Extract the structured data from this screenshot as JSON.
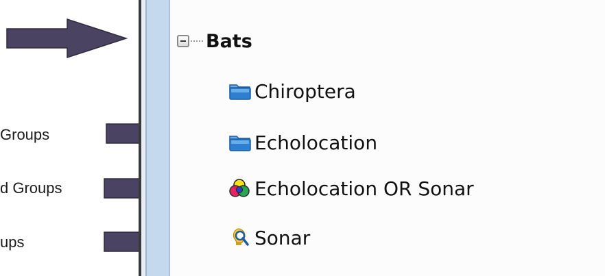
{
  "annotations": {
    "label_1": "Groups",
    "label_2": "d Groups",
    "label_3": "ups"
  },
  "tree": {
    "root": {
      "label": "Bats",
      "icon": "collapse-minus-icon"
    },
    "items": [
      {
        "label": "Chiroptera",
        "icon": "folder-icon"
      },
      {
        "label": "Echolocation",
        "icon": "folder-icon"
      },
      {
        "label": "Echolocation OR Sonar",
        "icon": "color-circles-icon"
      },
      {
        "label": "Sonar",
        "icon": "search-bulb-icon"
      }
    ]
  },
  "colors": {
    "arrow_fill": "#4a4462",
    "folder_blue": "#2f7fd0",
    "panel_divider": "#bcd3ea"
  }
}
